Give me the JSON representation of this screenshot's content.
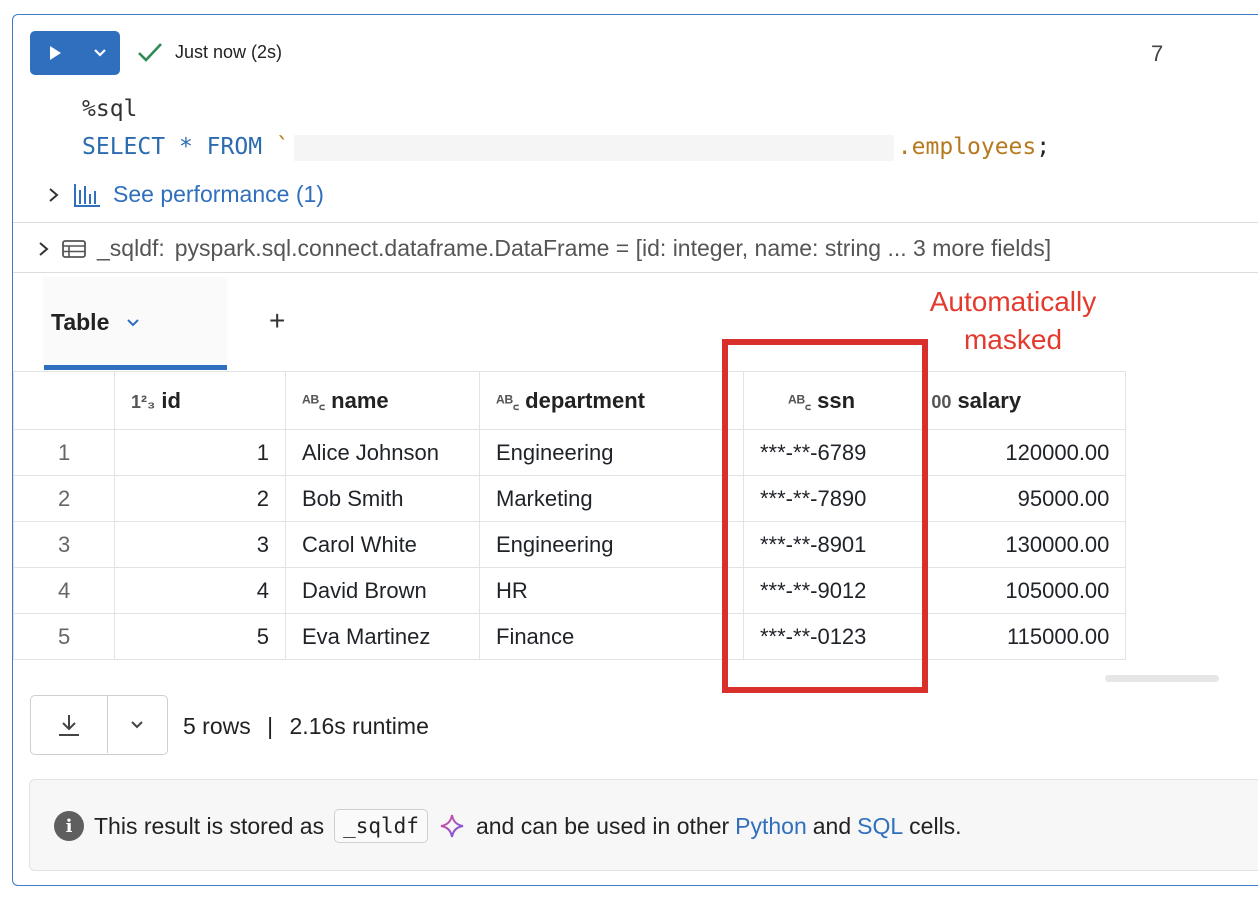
{
  "run": {
    "status": "Just now (2s)",
    "cell_number": "7"
  },
  "code": {
    "line1": "%sql",
    "select_kw": "SELECT",
    "star": "*",
    "from_kw": "FROM",
    "backtick": "`",
    "table_suffix": ".employees",
    "semicolon": ";"
  },
  "performance": {
    "label": "See performance (1)"
  },
  "schema": {
    "var": "_sqldf:",
    "text": "pyspark.sql.connect.dataframe.DataFrame = [id: integer, name: string ... 3 more fields]"
  },
  "tabs": {
    "active": "Table",
    "add": "+"
  },
  "annotation": {
    "line1": "Automatically",
    "line2": "masked"
  },
  "table": {
    "columns": [
      {
        "type": "1²₃",
        "label": "id"
      },
      {
        "type": "ᴬᴮ꜀",
        "label": "name"
      },
      {
        "type": "ᴬᴮ꜀",
        "label": "department"
      },
      {
        "type": "ᴬᴮ꜀",
        "label": "ssn"
      },
      {
        "type": "00",
        "label": "salary"
      }
    ],
    "rows": [
      {
        "n": "1",
        "id": "1",
        "name": "Alice Johnson",
        "department": "Engineering",
        "ssn": "***-**-6789",
        "salary": "120000.00"
      },
      {
        "n": "2",
        "id": "2",
        "name": "Bob Smith",
        "department": "Marketing",
        "ssn": "***-**-7890",
        "salary": "95000.00"
      },
      {
        "n": "3",
        "id": "3",
        "name": "Carol White",
        "department": "Engineering",
        "ssn": "***-**-8901",
        "salary": "130000.00"
      },
      {
        "n": "4",
        "id": "4",
        "name": "David Brown",
        "department": "HR",
        "ssn": "***-**-9012",
        "salary": "105000.00"
      },
      {
        "n": "5",
        "id": "5",
        "name": "Eva Martinez",
        "department": "Finance",
        "ssn": "***-**-0123",
        "salary": "115000.00"
      }
    ]
  },
  "summary": {
    "rows": "5 rows",
    "sep": "|",
    "runtime": "2.16s runtime"
  },
  "info": {
    "pre": "This result is stored as",
    "var": "_sqldf",
    "mid": "and can be used in other",
    "python": "Python",
    "and": "and",
    "sql": "SQL",
    "post": "cells."
  },
  "colors": {
    "accent": "#2f6fbd",
    "annotation": "#e23b2e",
    "highlight_box": "#d9302c",
    "success": "#2e8b57"
  }
}
